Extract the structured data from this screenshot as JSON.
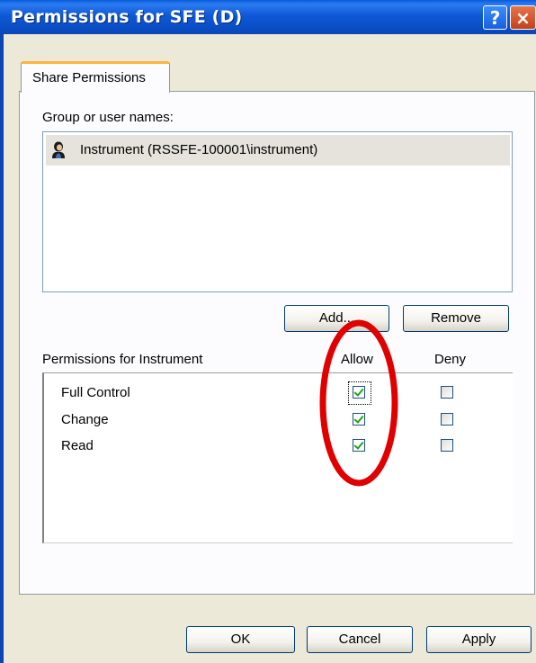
{
  "window": {
    "title": "Permissions for SFE (D)",
    "help_glyph": "?",
    "close_glyph": "×"
  },
  "tab": {
    "label": "Share Permissions"
  },
  "group": {
    "label": "Group or user names:",
    "items": [
      {
        "name": "Instrument (RSSFE-100001\\instrument)",
        "icon": "user-icon"
      }
    ]
  },
  "buttons": {
    "add": "Add...",
    "remove": "Remove",
    "ok": "OK",
    "cancel": "Cancel",
    "apply": "Apply"
  },
  "permissions": {
    "label": "Permissions for Instrument",
    "col_allow": "Allow",
    "col_deny": "Deny",
    "rows": [
      {
        "name": "Full Control",
        "allow": true,
        "deny": false
      },
      {
        "name": "Change",
        "allow": true,
        "deny": false
      },
      {
        "name": "Read",
        "allow": true,
        "deny": false
      }
    ]
  },
  "colors": {
    "title_bar": "#0a4ec6",
    "annotation": "#e00000",
    "dialog_bg": "#ece9d8"
  }
}
